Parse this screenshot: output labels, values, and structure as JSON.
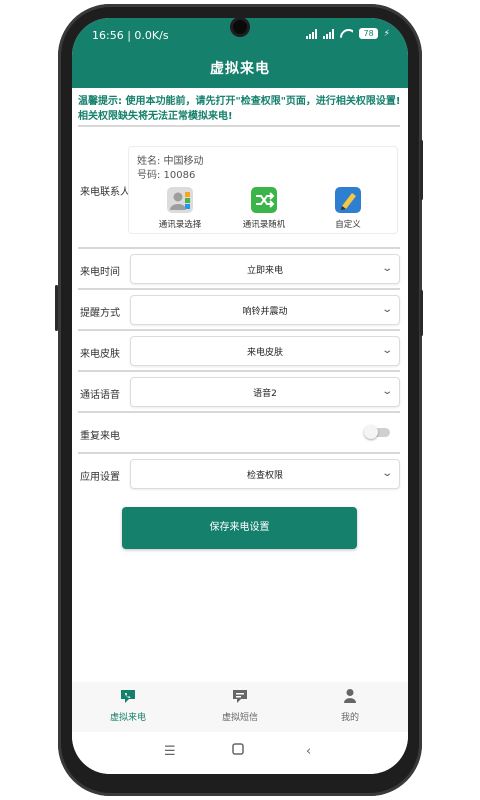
{
  "status_bar": {
    "time": "16:56 | 0.0K/s",
    "battery": "78"
  },
  "app_title": "虚拟来电",
  "notice": "温馨提示: 使用本功能前，请先打开\"检查权限\"页面，进行相关权限设置! 相关权限缺失将无法正常模拟来电!",
  "contact": {
    "label": "来电联系人",
    "name_line": "姓名: 中国移动",
    "number_line": "号码: 10086",
    "options": [
      {
        "label": "通讯录选择",
        "icon": "contacts-book-icon"
      },
      {
        "label": "通讯录随机",
        "icon": "shuffle-icon"
      },
      {
        "label": "自定义",
        "icon": "edit-pen-icon"
      }
    ]
  },
  "settings": [
    {
      "label": "来电时间",
      "value": "立即来电"
    },
    {
      "label": "提醒方式",
      "value": "响铃并震动"
    },
    {
      "label": "来电皮肤",
      "value": "来电皮肤"
    },
    {
      "label": "通话语音",
      "value": "语音2"
    },
    {
      "label": "重复来电",
      "toggle": false
    },
    {
      "label": "应用设置",
      "value": "检查权限"
    }
  ],
  "save_button": "保存来电设置",
  "tabs": [
    {
      "label": "虚拟来电",
      "icon": "phone-chat-icon",
      "active": true
    },
    {
      "label": "虚拟短信",
      "icon": "message-icon",
      "active": false
    },
    {
      "label": "我的",
      "icon": "person-icon",
      "active": false
    }
  ],
  "colors": {
    "primary": "#15806c",
    "inactive": "#666666"
  }
}
